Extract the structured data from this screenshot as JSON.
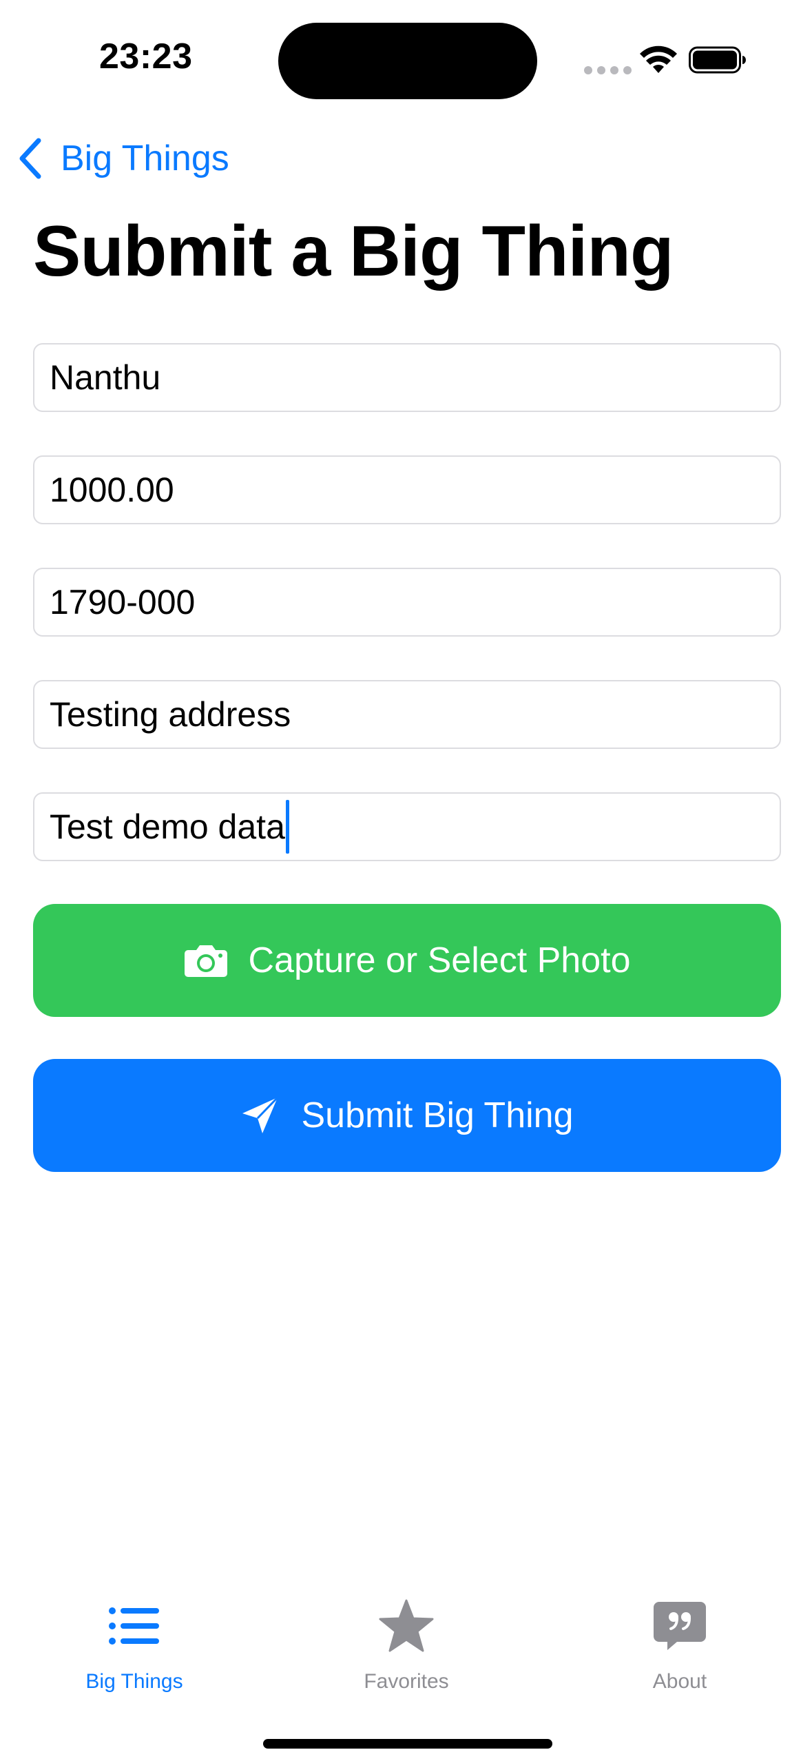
{
  "status_bar": {
    "time": "23:23"
  },
  "nav": {
    "back_label": "Big Things"
  },
  "page": {
    "title": "Submit a Big Thing"
  },
  "form": {
    "fields": [
      {
        "value": "Nanthu"
      },
      {
        "value": "1000.00"
      },
      {
        "value": "1790-000"
      },
      {
        "value": "Testing address"
      },
      {
        "value": "Test demo data",
        "focused": true
      }
    ],
    "photo_button_label": "Capture or Select Photo",
    "submit_button_label": "Submit Big Thing"
  },
  "tabbar": {
    "tabs": [
      {
        "label": "Big Things",
        "icon": "list-icon",
        "active": true
      },
      {
        "label": "Favorites",
        "icon": "star-icon",
        "active": false
      },
      {
        "label": "About",
        "icon": "quote-bubble-icon",
        "active": false
      }
    ]
  },
  "colors": {
    "accent": "#0a7aff",
    "green": "#34c759",
    "inactive": "#8e8e93"
  }
}
